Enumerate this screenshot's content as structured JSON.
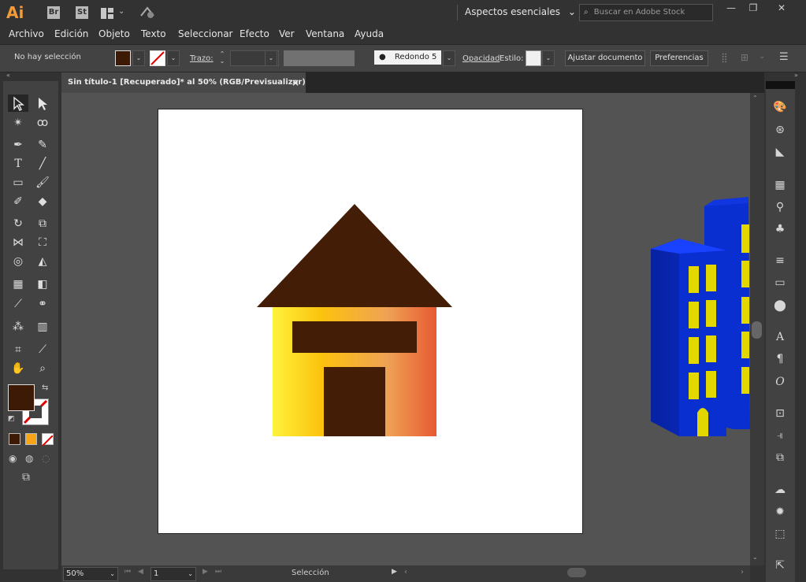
{
  "app": {
    "logo": "Ai",
    "bridge": "Br",
    "stock": "St",
    "workspace": "Aspectos esenciales",
    "search_placeholder": "Buscar en Adobe Stock"
  },
  "menu": [
    "Archivo",
    "Edición",
    "Objeto",
    "Texto",
    "Seleccionar",
    "Efecto",
    "Ver",
    "Ventana",
    "Ayuda"
  ],
  "control": {
    "selection_status": "No hay selección",
    "fill_color": "#3d1a05",
    "stroke_label": "Trazo:",
    "brush_label": "Redondo 5 ...",
    "opacity_label": "Opacidad",
    "style_label": "Estilo:",
    "adjust_button": "Ajustar documento",
    "prefs_button": "Preferencias"
  },
  "document": {
    "tab_title": "Sin título-1 [Recuperado]* al 50% (RGB/Previsualizar)",
    "close": "×"
  },
  "colors": {
    "house_roof": "#431d05",
    "house_door": "#431d05",
    "gradient_start": "#fff23c",
    "gradient_mid": "#fbc20d",
    "gradient_end": "#e75a32",
    "building_blue": "#0a2fd0",
    "window_yellow": "#e2d800"
  },
  "status": {
    "zoom": "50%",
    "page": "1",
    "tool_name": "Selección"
  }
}
